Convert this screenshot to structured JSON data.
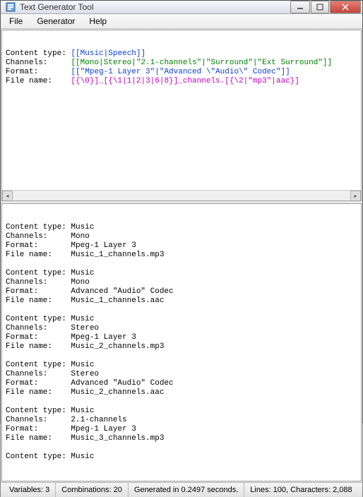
{
  "window": {
    "title": "Text Generator Tool"
  },
  "menubar": {
    "file": "File",
    "generator": "Generator",
    "help": "Help"
  },
  "template": {
    "content_type_label": "Content type:",
    "channels_label": "Channels:",
    "format_label": "Format:",
    "filename_label": "File name:",
    "content_type_expr": "[[Music|Speech]]",
    "channels_expr": "[[Mono|Stereo|\"2.1-channels\"|\"Surround\"|\"Ext Surround\"]]",
    "format_expr": "[[\"Mpeg-1 Layer 3\"|\"Advanced \\\"Audio\\\" Codec\"]]",
    "filename_expr": "[{\\0}]_[{\\1|1|2|3|6|8}]_channels.[{\\2|\"mp3\"|aac}]"
  },
  "output": {
    "blocks": [
      {
        "content_type": "Music",
        "channels": "Mono",
        "format": "Mpeg-1 Layer 3",
        "file_name": "Music_1_channels.mp3"
      },
      {
        "content_type": "Music",
        "channels": "Mono",
        "format": "Advanced \"Audio\" Codec",
        "file_name": "Music_1_channels.aac"
      },
      {
        "content_type": "Music",
        "channels": "Stereo",
        "format": "Mpeg-1 Layer 3",
        "file_name": "Music_2_channels.mp3"
      },
      {
        "content_type": "Music",
        "channels": "Stereo",
        "format": "Advanced \"Audio\" Codec",
        "file_name": "Music_2_channels.aac"
      },
      {
        "content_type": "Music",
        "channels": "2.1-channels",
        "format": "Mpeg-1 Layer 3",
        "file_name": "Music_3_channels.mp3"
      },
      {
        "content_type": "Music"
      }
    ],
    "labels": {
      "content_type": "Content type:",
      "channels": "Channels:",
      "format": "Format:",
      "file_name": "File name:"
    }
  },
  "statusbar": {
    "variables": "Variables: 3",
    "combinations": "Combinations: 20",
    "generated": "Generated in 0.2497 seconds.",
    "lines": "Lines: 100, Characters: 2,088"
  }
}
